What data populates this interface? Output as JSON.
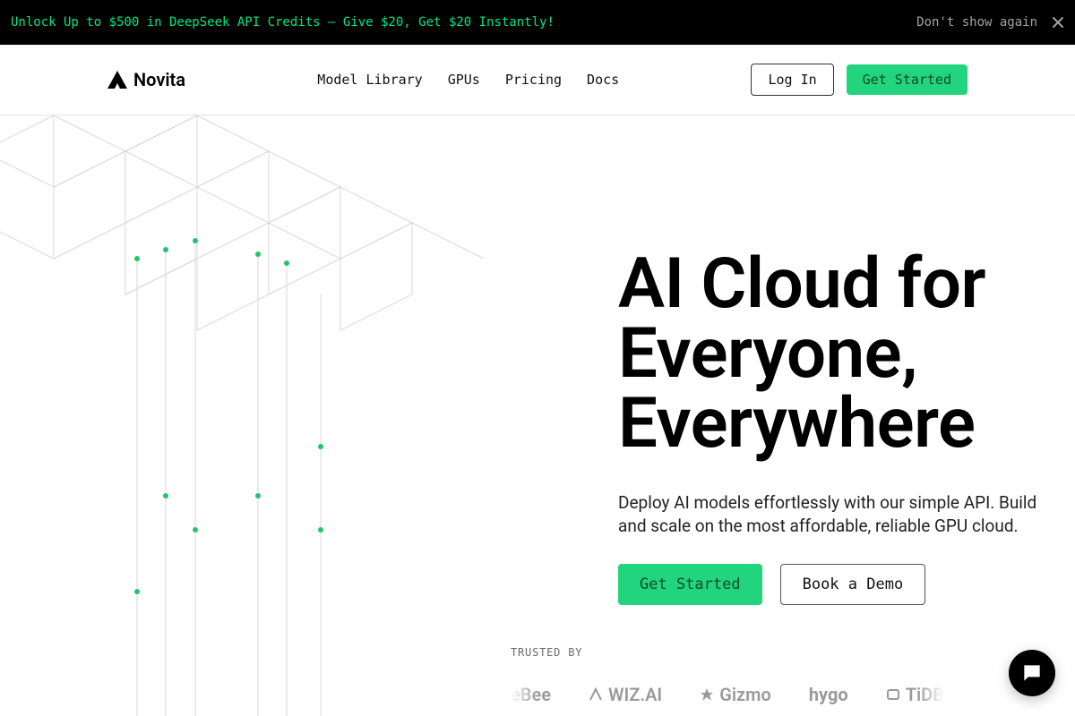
{
  "promo": {
    "text": "Unlock Up to $500 in DeepSeek API Credits – Give $20, Get $20 Instantly!",
    "dismiss": "Don't show again"
  },
  "brand": {
    "name": "Novita"
  },
  "nav": {
    "item0": "Model Library",
    "item1": "GPUs",
    "item2": "Pricing",
    "item3": "Docs"
  },
  "header": {
    "login": "Log In",
    "get_started": "Get Started"
  },
  "hero": {
    "title_l1": "AI Cloud for",
    "title_l2": "Everyone,",
    "title_l3": "Everywhere",
    "subtitle": "Deploy AI models effortlessly with our simple API. Build and scale on the most affordable, reliable GPU cloud.",
    "cta_primary": "Get Started",
    "cta_secondary": "Book a Demo"
  },
  "trusted": {
    "label": "TRUSTED BY",
    "logo0": "eBee",
    "logo1": "WIZ.AI",
    "logo2": "Gizmo",
    "logo3": "hygo",
    "logo4": "TiDB"
  }
}
